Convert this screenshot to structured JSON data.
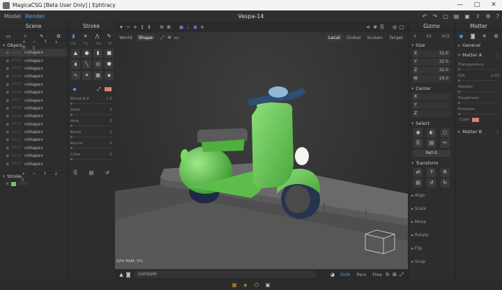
{
  "window": {
    "title": "MagicaCSG [Beta User Only] | Ephtracy",
    "controls": [
      "—",
      "□",
      "✕"
    ]
  },
  "menu": {
    "model": "Model",
    "render": "Render",
    "document": "Vespa-14"
  },
  "scene": {
    "title": "Scene",
    "object_section": "Object",
    "shapes": [
      {
        "idx": "0001",
        "label": "<shape>"
      },
      {
        "idx": "0002",
        "label": "<shape>"
      },
      {
        "idx": "0003",
        "label": "<shape>"
      },
      {
        "idx": "0004",
        "label": "<shape>"
      },
      {
        "idx": "0005",
        "label": "<shape>"
      },
      {
        "idx": "0006",
        "label": "<shape>"
      },
      {
        "idx": "0007",
        "label": "<shape>"
      },
      {
        "idx": "0008",
        "label": "<shape>"
      },
      {
        "idx": "0009",
        "label": "<shape>"
      },
      {
        "idx": "0010",
        "label": "<shape>"
      },
      {
        "idx": "0011",
        "label": "<shape>"
      },
      {
        "idx": "0012",
        "label": "<shape>"
      },
      {
        "idx": "0013",
        "label": "<shape>"
      },
      {
        "idx": "0014",
        "label": "<shape>"
      },
      {
        "idx": "0015",
        "label": "<shape>"
      }
    ],
    "stroke_section": "Stroke",
    "stroke_item": "0001"
  },
  "stroke": {
    "title": "Stroke",
    "mode_tabs": [
      "Hx",
      "Hy",
      "Hz",
      "M"
    ],
    "blend_label": "Blend",
    "blend_a": "A",
    "blend_b": "B",
    "blend_value": "1.0",
    "sliders": [
      {
        "label": "Shell",
        "value": "0"
      },
      {
        "label": "Hole",
        "value": "0"
      },
      {
        "label": "Bevel",
        "value": "0"
      },
      {
        "label": "Round",
        "value": "0"
      },
      {
        "label": "Cone",
        "value": "0"
      }
    ]
  },
  "viewport": {
    "space_tabs": [
      "World",
      "Shape"
    ],
    "active_space": "Shape",
    "coord_tabs": [
      "Local",
      "Global",
      "Screen",
      "Target"
    ],
    "active_coord": "Local",
    "gpu_ram": "GPU RAM: 5%",
    "step_value": "1",
    "console_text": "console",
    "proj_tabs": [
      "Orth",
      "Pers",
      "Free"
    ],
    "active_proj": "Orth"
  },
  "gizmo": {
    "title": "Gizmo",
    "axis_tabs": [
      "X",
      "XY",
      "XYZ"
    ],
    "size_label": "Size",
    "size": [
      {
        "axis": "X",
        "value": "32.0"
      },
      {
        "axis": "Y",
        "value": "32.0"
      },
      {
        "axis": "Z",
        "value": "32.0"
      },
      {
        "axis": "W",
        "value": "16.0"
      }
    ],
    "center_label": "Center",
    "center": [
      {
        "axis": "X",
        "value": ""
      },
      {
        "axis": "Y",
        "value": ""
      },
      {
        "axis": "Z",
        "value": ""
      }
    ],
    "select_label": "Select",
    "ref_button": "Ref-O",
    "transform_label": "Transform",
    "transform_btns": [
      "T",
      "R"
    ],
    "collapsed": [
      "Align",
      "Scale",
      "Move",
      "Rotate",
      "Flip",
      "Snap"
    ]
  },
  "matter": {
    "title": "Matter",
    "general": "General",
    "matter_a": "Matter A",
    "props": [
      {
        "label": "Transparency",
        "value": ""
      },
      {
        "label": "IOR",
        "value": "1.00"
      },
      {
        "label": "Metallic",
        "value": ""
      },
      {
        "label": "Roughness",
        "value": ""
      },
      {
        "label": "Emission",
        "value": ""
      }
    ],
    "color_label": "Color",
    "color": "#d98070",
    "matter_b": "Matter B"
  },
  "colors": {
    "accent": "#4aa3ff",
    "purple": "#9a6bff",
    "body": "#6ec85a",
    "seat": "#5a5a5a",
    "handle": "#2c4f73",
    "tire": "#27344f"
  }
}
